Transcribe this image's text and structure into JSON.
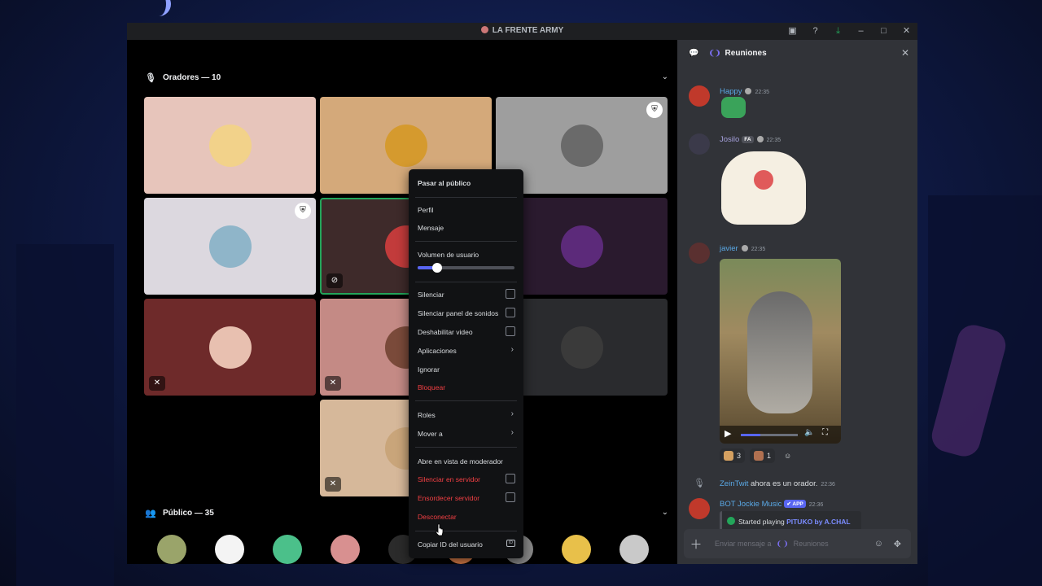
{
  "colors": {
    "accent": "#5865f2",
    "danger": "#f23f43",
    "mention": "#7b6ff2",
    "bg_chat": "#313338",
    "menu_bg": "#111214"
  },
  "window": {
    "title": "LA FRENTE ARMY",
    "controls": [
      "inbox-icon",
      "help-icon",
      "download-icon",
      "minimize-icon",
      "maximize-icon",
      "close-icon"
    ]
  },
  "stage": {
    "speakers_label": "Oradores — 10",
    "audience_label": "Público — 35",
    "tile_colors": [
      "#e7c5bb",
      "#d4a97a",
      "#9e9e9e",
      "#dcd8df",
      "#3e2a2a",
      "#2a1a2e",
      "#6e2a2a",
      "#c48a85",
      "#2a2b2e",
      "#d6b89a"
    ],
    "avatar_colors": [
      "#f2d28a",
      "#d59a2e",
      "#6a6a6a",
      "#8fb5c9",
      "#c23b3b",
      "#5c2a7a",
      "#e8c0b0",
      "#7a4a3a",
      "#3a3a3a",
      "#c9a57a"
    ],
    "audience_colors": [
      "#9aa46a",
      "#f4f4f4",
      "#4bc08a",
      "#d89090",
      "#2b2b2b",
      "#e0804a",
      "#888888",
      "#e8c04a",
      "#c9c9c9"
    ]
  },
  "chat": {
    "channel_name": "Reuniones",
    "messages": [
      {
        "author": "Happy",
        "time": "22:35",
        "author_color": "#5aa9e6",
        "avatar": "#c0392b"
      },
      {
        "author": "Josilo",
        "tag": "FA",
        "time": "22:35",
        "author_color": "#a5a0dc",
        "avatar": "#3b3a4a"
      },
      {
        "author": "javier",
        "time": "22:35",
        "author_color": "#5aa9e6",
        "avatar": "#5a3030"
      },
      {
        "author": "ZeinTwit",
        "text": "ahora es un orador.",
        "time": "22:36",
        "author_color": "#5aa9e6"
      },
      {
        "author": "BOT Jockie Music",
        "app_tag": "APP",
        "time": "22:36",
        "author_color": "#5aa9e6",
        "avatar": "#c0392b",
        "embed_prefix": "Started playing",
        "embed_song": "PITUKO by A.CHAL"
      }
    ],
    "reactions": [
      {
        "count": "3",
        "color": "#d4a060"
      },
      {
        "count": "1",
        "color": "#b07050"
      }
    ],
    "input_placeholder": "Enviar mensaje a",
    "input_channel": "Reuniones"
  },
  "context_menu": {
    "volume_level": 0.2,
    "items": {
      "pasar_publico": "Pasar al público",
      "perfil": "Perfil",
      "mensaje": "Mensaje",
      "volumen": "Volumen de usuario",
      "silenciar": "Silenciar",
      "silenciar_sonidos": "Silenciar panel de sonidos",
      "deshabilitar_video": "Deshabilitar video",
      "aplicaciones": "Aplicaciones",
      "ignorar": "Ignorar",
      "bloquear": "Bloquear",
      "roles": "Roles",
      "mover_a": "Mover a",
      "vista_moderador": "Abre en vista de moderador",
      "silenciar_servidor": "Silenciar en servidor",
      "ensordecer_servidor": "Ensordecer servidor",
      "desconectar": "Desconectar",
      "copiar_id": "Copiar ID del usuario"
    }
  }
}
